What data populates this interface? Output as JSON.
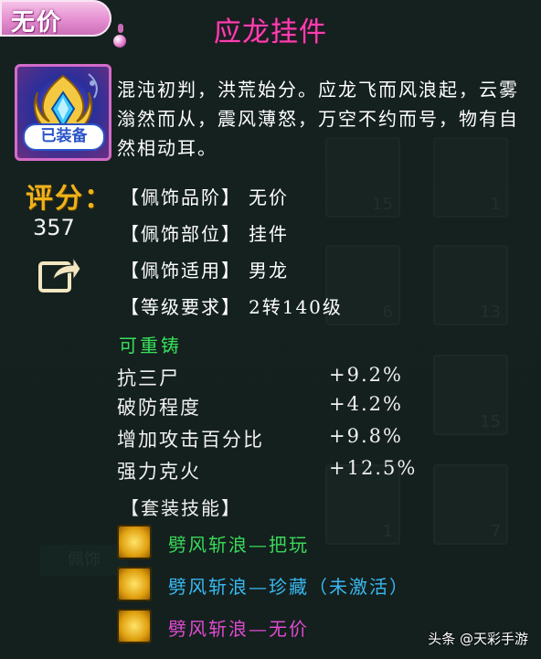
{
  "item": {
    "grade_tag": "无价",
    "name": "应龙挂件",
    "equipped_badge": "已装备",
    "description": "混沌初判，洪荒始分。应龙飞而风浪起，云雾滃然而从，震风薄怒，万空不约而号，物有自然相动耳。"
  },
  "score": {
    "label": "评分：",
    "value": "357"
  },
  "attributes": [
    {
      "key": "【佩饰品阶】",
      "value": "无价"
    },
    {
      "key": "【佩饰部位】",
      "value": "挂件"
    },
    {
      "key": "【佩饰适用】",
      "value": "男龙"
    },
    {
      "key": "【等级要求】",
      "value": "2转140级"
    }
  ],
  "recast_label": "可重铸",
  "stats": [
    {
      "name": "抗三尸",
      "value": "+9.2%"
    },
    {
      "name": "破防程度",
      "value": "+4.2%"
    },
    {
      "name": "增加攻击百分比",
      "value": "+9.8%"
    },
    {
      "name": "强力克火",
      "value": "+12.5%"
    }
  ],
  "set_skills": {
    "title": "【套装技能】",
    "items": [
      {
        "name": "劈风斩浪—把玩",
        "color": "#39d85a"
      },
      {
        "name": "劈风斩浪—珍藏（未激活）",
        "color": "#39b8f0"
      },
      {
        "name": "劈风斩浪—无价",
        "color": "#e04ad0"
      }
    ]
  },
  "background": {
    "slot_counts": [
      "15",
      "1",
      "6",
      "13",
      "15",
      "1",
      "7"
    ],
    "left_button": "佩饰"
  },
  "watermark": "头条 @天彩手游",
  "colors": {
    "title": "#ff3fb0",
    "score_label": "#f0b21a",
    "recast": "#39e05a"
  }
}
